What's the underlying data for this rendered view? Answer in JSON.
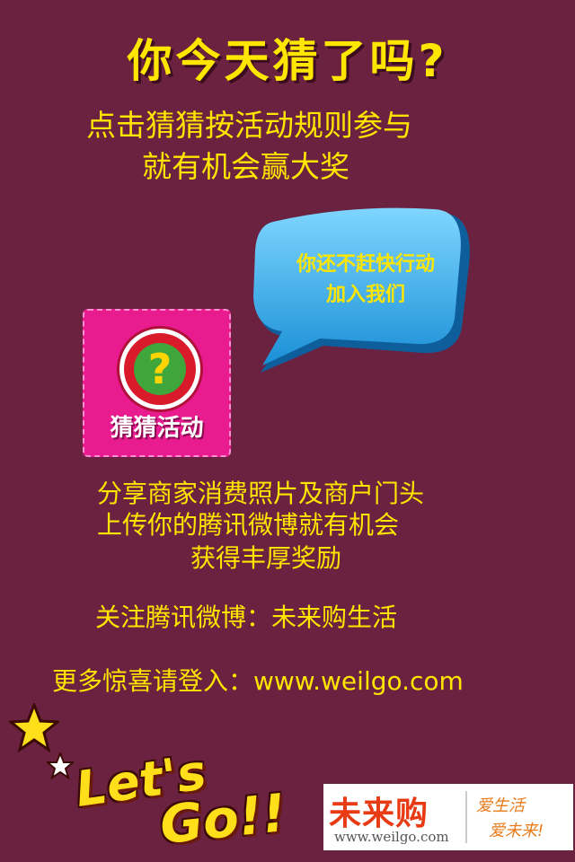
{
  "headline": "你今天猜了吗?",
  "intro": {
    "line1": "点击猜猜按活动规则参与",
    "line2": "就有机会赢大奖"
  },
  "bubble": {
    "line1": "你还不赶快行动",
    "line2": "加入我们"
  },
  "app_icon": {
    "label": "猜猜活动",
    "symbol": "?"
  },
  "body": {
    "line1": "分享商家消费照片及商户门头",
    "line2": "上传你的腾讯微博就有机会",
    "line3": "获得丰厚奖励"
  },
  "follow": "关注腾讯微博：未来购生活",
  "more": "更多惊喜请登入：www.weilgo.com",
  "lets_go": {
    "line1": "Let's",
    "line2": "Go!!"
  },
  "logo": {
    "name": "未来购",
    "url": "www.weilgo.com",
    "slogan1": "爱生活",
    "slogan2": "爱未来!"
  },
  "colors": {
    "background": "#6b2240",
    "text": "#ffe600",
    "bubble": "#3cb4f0",
    "icon_bg": "#e91c8f"
  }
}
